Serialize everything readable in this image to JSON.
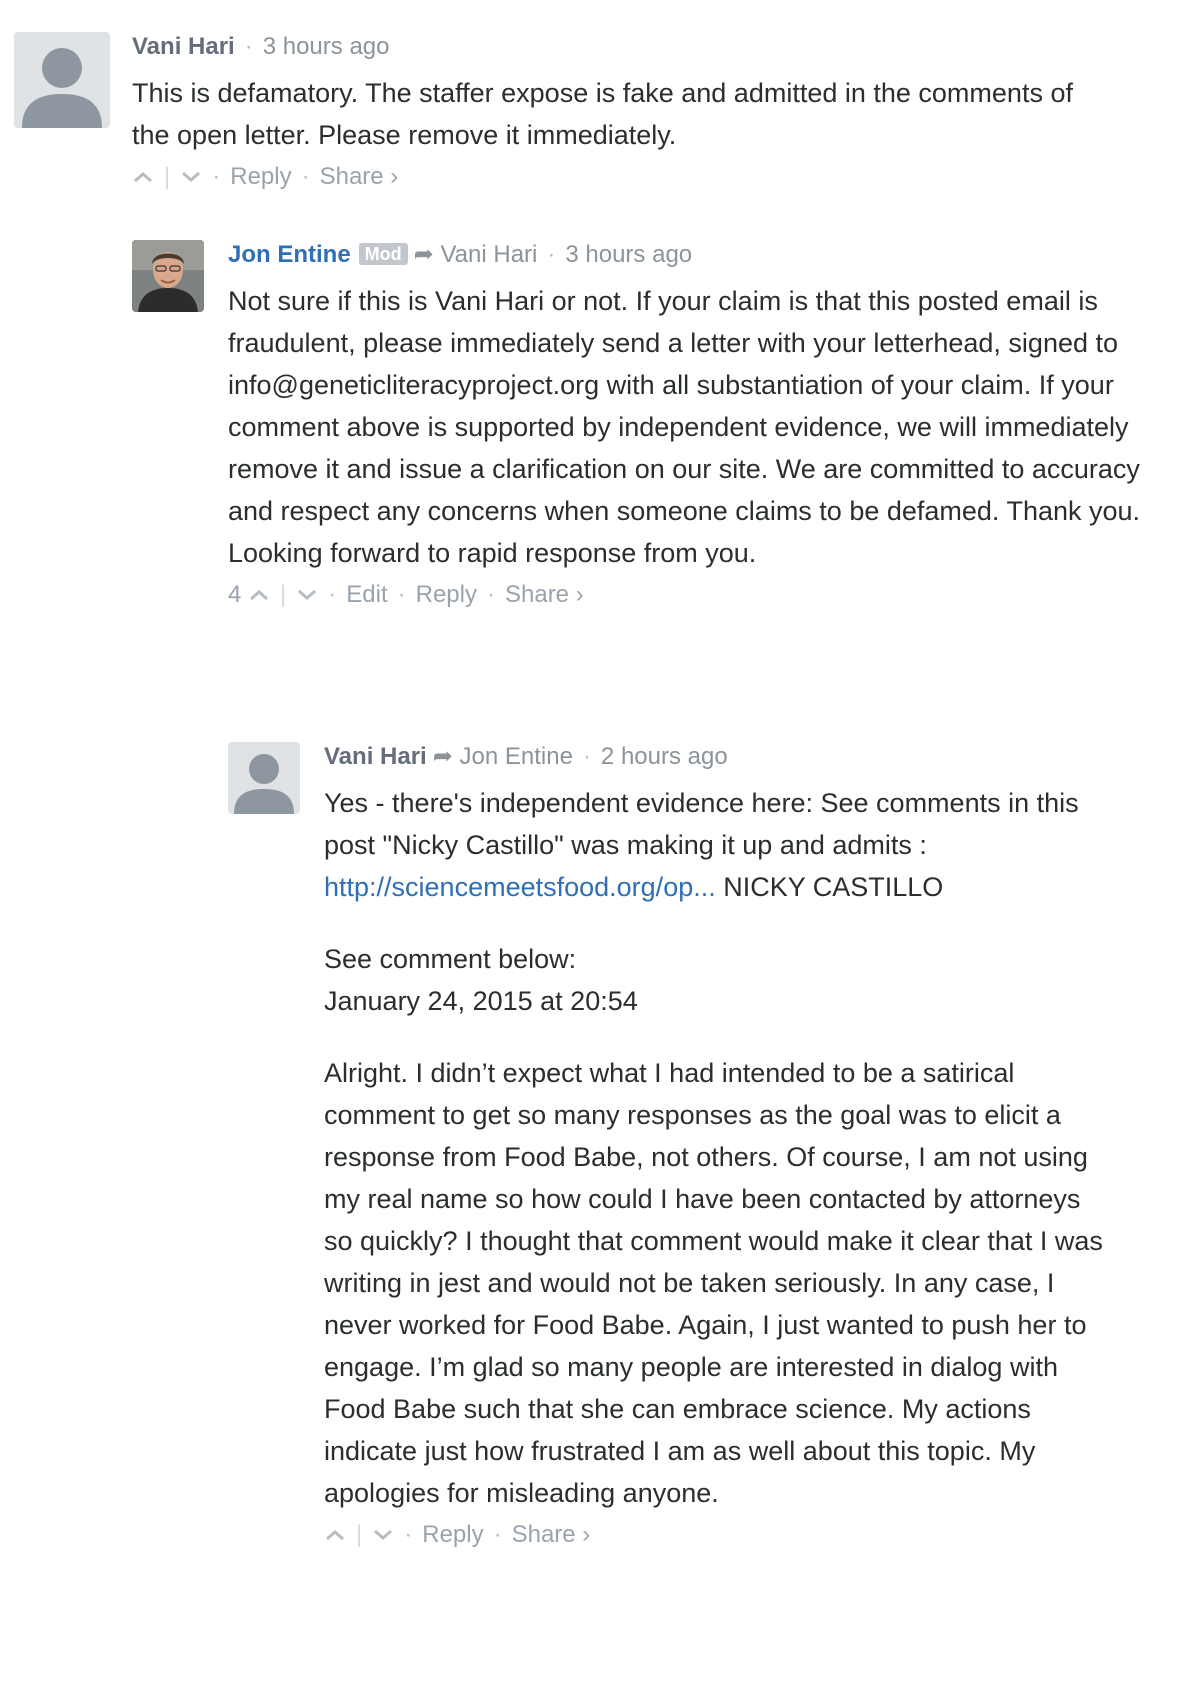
{
  "comments": [
    {
      "author": "Vani Hari",
      "time": "3 hours ago",
      "paragraphs": [
        "This is defamatory. The staffer expose is fake and admitted in the comments of the open letter. Please remove it immediately."
      ],
      "actions": {
        "reply": "Reply",
        "share": "Share ›"
      }
    },
    {
      "author": "Jon Entine",
      "badge": "Mod",
      "reply_to": "Vani Hari",
      "time": "3 hours ago",
      "paragraphs": [
        "Not sure if this is Vani Hari or not. If your claim is that this posted email is fraudulent, please immediately send a letter with your letterhead, signed to info@geneticliteracyproject.org with all substantiation of your claim. If your comment above is supported by independent evidence, we will immediately remove it and issue a clarification on our site. We are committed to accuracy and respect any concerns when someone claims to be defamed. Thank you. Looking forward to rapid response from you."
      ],
      "upvotes": "4",
      "actions": {
        "edit": "Edit",
        "reply": "Reply",
        "share": "Share ›"
      }
    },
    {
      "author": "Vani Hari",
      "reply_to": "Jon Entine",
      "time": "2 hours ago",
      "p1_before": "Yes - there's independent evidence here: See comments in this post \"Nicky Castillo\" was making it up and admits : ",
      "link": "http://sciencemeetsfood.org/op...",
      "p1_after": " NICKY CASTILLO",
      "p2_line1": "See comment below:",
      "p2_line2": "January 24, 2015 at 20:54",
      "p3": "Alright. I didn’t expect what I had intended to be a satirical comment to get so many responses as the goal was to elicit a response from Food Babe, not others. Of course, I am not using my real name so how could I have been contacted by attorneys so quickly? I thought that comment would make it clear that I was writing in jest and would not be taken seriously. In any case, I never worked for Food Babe. Again, I just wanted to push her to engage. I’m glad so many people are interested in dialog with Food Babe such that she can embrace science. My actions indicate just how frustrated I am as well about this topic. My apologies for misleading anyone.",
      "actions": {
        "reply": "Reply",
        "share": "Share ›"
      }
    }
  ],
  "icons": {
    "upvote": "chevron-up-icon",
    "downvote": "chevron-down-icon",
    "reply_arrow": "reply-arrow-icon",
    "avatar": "default-avatar-icon"
  },
  "colors": {
    "link": "#2e6fb5",
    "mod_author": "#2e6fb5",
    "meta": "#8a949a",
    "text": "#2a2e2e"
  }
}
